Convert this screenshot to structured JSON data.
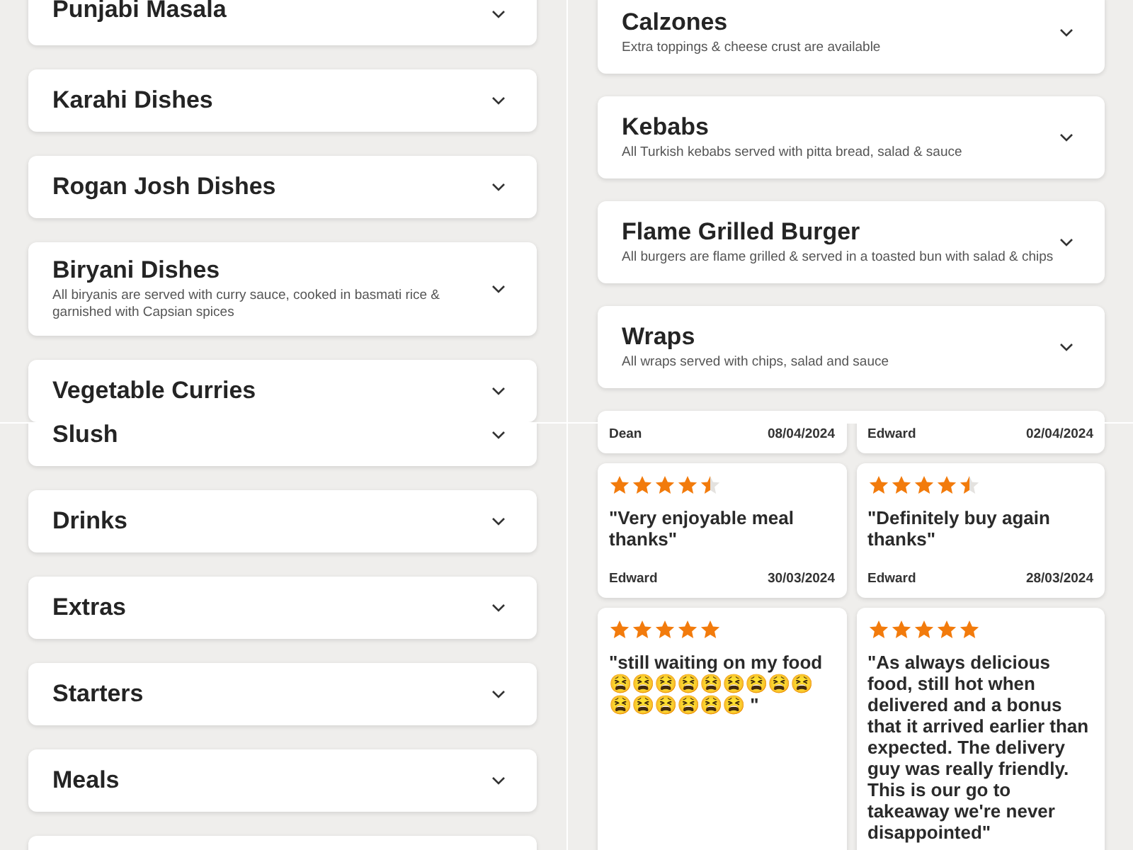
{
  "panels": [
    {
      "kind": "categories",
      "partial_card_below": false,
      "items": [
        {
          "title": "Punjabi Masala"
        },
        {
          "title": "Karahi Dishes"
        },
        {
          "title": "Rogan Josh Dishes"
        },
        {
          "title": "Biryani Dishes",
          "description": "All biryanis are served with curry sauce, cooked in basmati rice & garnished with Capsian spices"
        },
        {
          "title": "Vegetable Curries"
        }
      ]
    },
    {
      "kind": "categories",
      "partial_card_below": true,
      "items": [
        {
          "title": "Calzones",
          "description": "Extra toppings & cheese crust are available"
        },
        {
          "title": "Kebabs",
          "description": "All Turkish kebabs served with pitta bread, salad & sauce"
        },
        {
          "title": "Flame Grilled Burger",
          "description": "All burgers are flame grilled & served in a toasted bun with salad & chips"
        },
        {
          "title": "Wraps",
          "description": "All wraps served with chips, salad and sauce"
        }
      ]
    },
    {
      "kind": "categories",
      "partial_card_below": true,
      "items": [
        {
          "title": "Slush"
        },
        {
          "title": "Drinks"
        },
        {
          "title": "Extras"
        },
        {
          "title": "Starters"
        },
        {
          "title": "Meals"
        }
      ]
    },
    {
      "kind": "reviews",
      "items": [
        {
          "author": "Dean",
          "date": "08/04/2024"
        },
        {
          "author": "Edward",
          "date": "02/04/2024"
        },
        {
          "stars": 4.5,
          "text": "\"Very enjoyable meal thanks\"",
          "author": "Edward",
          "date": "30/03/2024"
        },
        {
          "stars": 4.5,
          "text": "\"Definitely buy again thanks\"",
          "author": "Edward",
          "date": "28/03/2024"
        },
        {
          "stars": 5,
          "text": "\"still waiting on my food 😫😫😫😫😫😫😫😫😫😫😫😫😫😫😫 \""
        },
        {
          "stars": 5,
          "text": "\"As always delicious food, still hot when delivered and a bonus that it arrived earlier than expected. The delivery guy was really friendly. This is our go to takeaway we're never disappointed\""
        }
      ]
    }
  ]
}
